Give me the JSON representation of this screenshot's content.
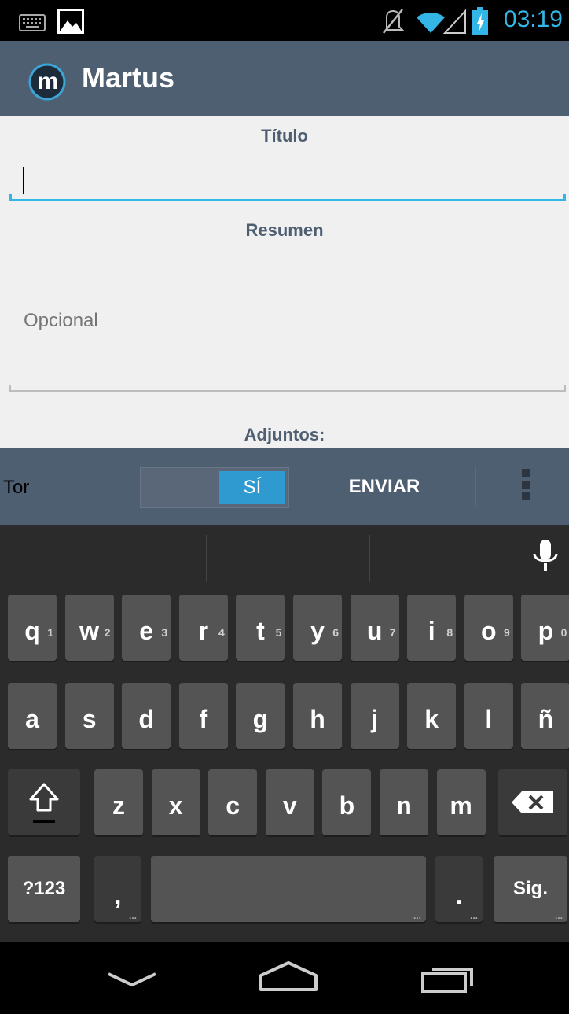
{
  "status_bar": {
    "time": "03:19",
    "icons": [
      "keyboard-icon",
      "image-icon",
      "mute-icon",
      "wifi-icon",
      "signal-icon",
      "battery-icon"
    ]
  },
  "action_bar": {
    "app_title": "Martus",
    "logo_letter": "m"
  },
  "form": {
    "title_label": "Título",
    "title_value": "",
    "summary_label": "Resumen",
    "summary_placeholder": "Opcional",
    "attachments_label": "Adjuntos:"
  },
  "bottom_bar": {
    "tor_label": "Tor",
    "toggle_label": "SÍ",
    "toggle_on": true,
    "send_label": "ENVIAR"
  },
  "keyboard": {
    "row1": [
      {
        "key": "q",
        "hint": "1"
      },
      {
        "key": "w",
        "hint": "2"
      },
      {
        "key": "e",
        "hint": "3"
      },
      {
        "key": "r",
        "hint": "4"
      },
      {
        "key": "t",
        "hint": "5"
      },
      {
        "key": "y",
        "hint": "6"
      },
      {
        "key": "u",
        "hint": "7"
      },
      {
        "key": "i",
        "hint": "8"
      },
      {
        "key": "o",
        "hint": "9"
      },
      {
        "key": "p",
        "hint": "0"
      }
    ],
    "row2": [
      "a",
      "s",
      "d",
      "f",
      "g",
      "h",
      "j",
      "k",
      "l",
      "ñ"
    ],
    "row3": [
      "z",
      "x",
      "c",
      "v",
      "b",
      "n",
      "m"
    ],
    "symbols_label": "?123",
    "comma_label": ",",
    "period_label": ".",
    "next_label": "Sig."
  },
  "colors": {
    "accent": "#33b5e5",
    "action_bar": "#4f5f72",
    "form_bg": "#f0f0f0",
    "key_bg": "#545454"
  }
}
